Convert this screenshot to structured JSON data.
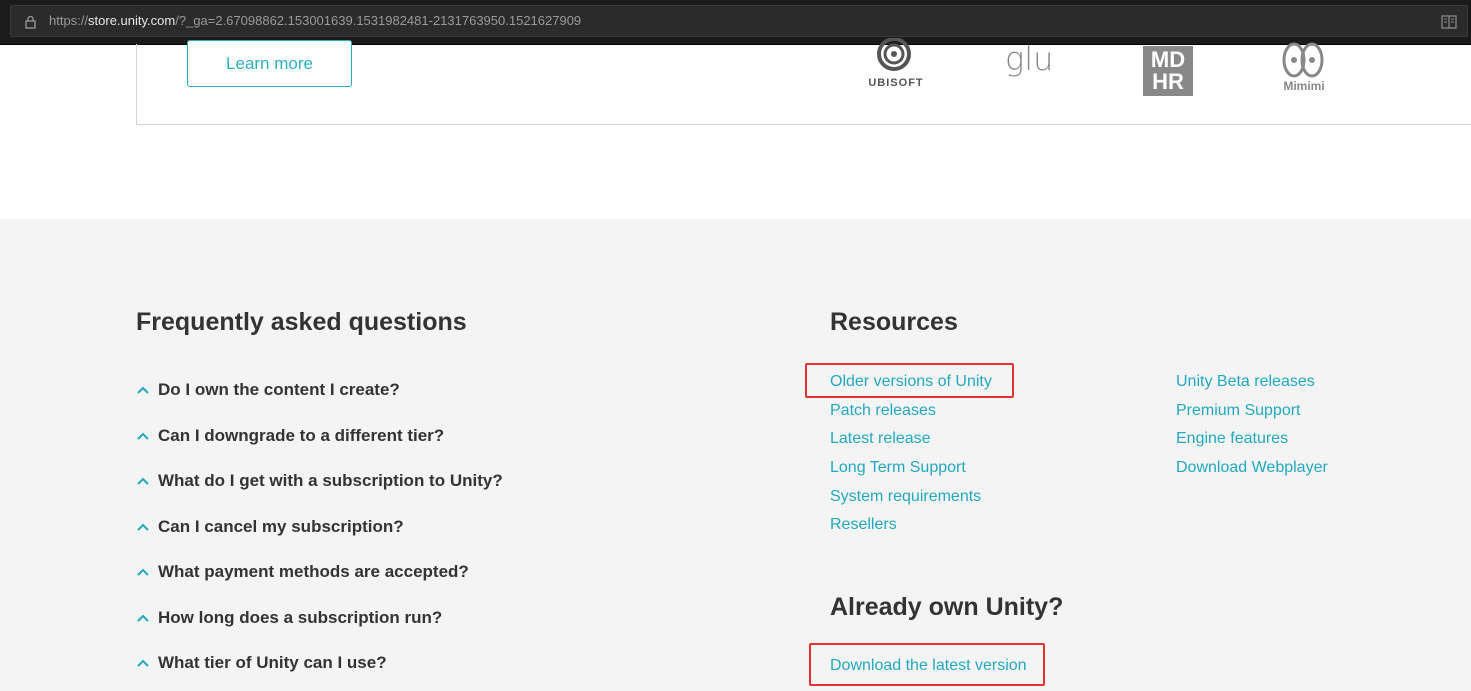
{
  "browser": {
    "url_scheme": "https://",
    "url_host": "store.unity.com",
    "url_rest": "/?_ga=2.67098862.153001639.1531982481-2131763950.1521627909"
  },
  "top": {
    "learn_more": "Learn more",
    "logos": {
      "ubisoft": "UBISOFT",
      "glu": "glu",
      "mdhr_1": "MD",
      "mdhr_2": "HR",
      "mimimi": "Mimimi"
    }
  },
  "faq": {
    "title": "Frequently asked questions",
    "items": [
      "Do I own the content I create?",
      "Can I downgrade to a different tier?",
      "What do I get with a subscription to Unity?",
      "Can I cancel my subscription?",
      "What payment methods are accepted?",
      "How long does a subscription run?",
      "What tier of Unity can I use?"
    ]
  },
  "resources": {
    "title": "Resources",
    "col1": [
      "Older versions of Unity",
      "Patch releases",
      "Latest release",
      "Long Term Support",
      "System requirements",
      "Resellers"
    ],
    "col2": [
      "Unity Beta releases",
      "Premium Support",
      "Engine features",
      "Download Webplayer"
    ]
  },
  "own": {
    "title": "Already own Unity?",
    "download": "Download the latest version"
  },
  "colors": {
    "accent": "#22a8c0",
    "highlight": "#e23232",
    "footer_bg": "#f4f4f4"
  }
}
